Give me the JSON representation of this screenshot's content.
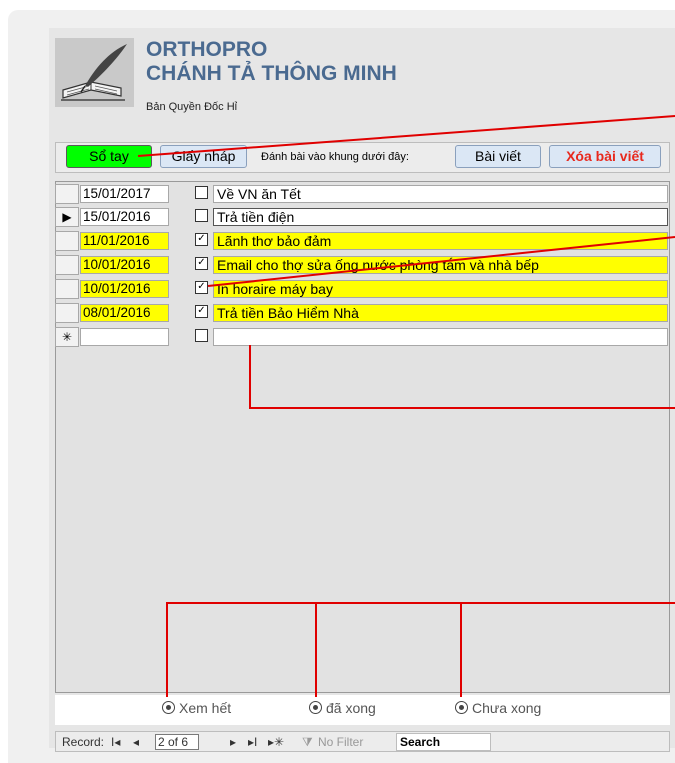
{
  "header": {
    "title": "ORTHOPRO",
    "subtitle": "CHÁNH TẢ THÔNG MINH",
    "copyright": "Bản Quyền Đốc Hỉ"
  },
  "toolbar": {
    "notebook_label": "Sổ tay",
    "draft_label": "Giấy nháp",
    "hint": "Đánh bài vào khung dưới đây:",
    "article_label": "Bài viết",
    "delete_label": "Xóa bài viết"
  },
  "records": [
    {
      "date": "15/01/2017",
      "done": false,
      "title": "Về VN ăn Tết",
      "selector": ""
    },
    {
      "date": "15/01/2016",
      "done": false,
      "title": "Trả tiền điện",
      "selector": "▶"
    },
    {
      "date": "11/01/2016",
      "done": true,
      "title": "Lãnh thơ bảo đảm",
      "selector": ""
    },
    {
      "date": "10/01/2016",
      "done": true,
      "title": "Email cho thợ sửa ống nước phòng tắm và nhà bếp",
      "selector": ""
    },
    {
      "date": "10/01/2016",
      "done": true,
      "title": "In horaire máy bay",
      "selector": ""
    },
    {
      "date": "08/01/2016",
      "done": true,
      "title": "Trả tiền Bảo Hiểm Nhà",
      "selector": ""
    },
    {
      "date": "",
      "done": false,
      "title": "",
      "selector": "✳"
    }
  ],
  "filters": {
    "all": "Xem hết",
    "done": "đã xong",
    "not_done": "Chưa xong"
  },
  "navbar": {
    "record_label": "Record:",
    "first": "I◂",
    "prev": "◂",
    "position": "2 of 6",
    "next": "▸",
    "last": "▸I",
    "new": "▸✳",
    "filter_icon": "funnel-icon",
    "no_filter": "No Filter",
    "search": "Search"
  },
  "colors": {
    "accent": "#4a6a90",
    "notebook_button": "#00ff00",
    "done_row": "#ffff00",
    "delete_text": "#e8291e",
    "annotation": "#e00000"
  }
}
